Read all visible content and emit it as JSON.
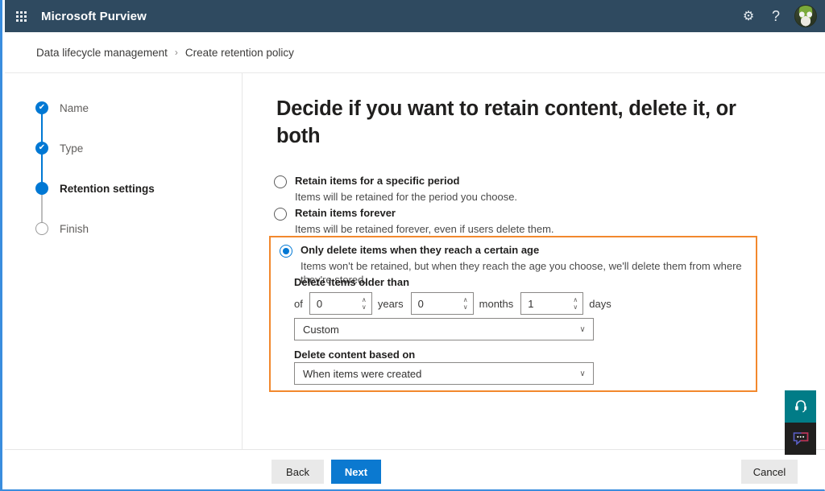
{
  "colors": {
    "header_bg": "#2f4a60",
    "accent_blue": "#0078d4",
    "primary_button": "#0b79d0",
    "highlight_border": "#f2882d",
    "help_widget_teal": "#017c87",
    "feedback_widget_dark": "#201f1e"
  },
  "header": {
    "waffle_icon": "app-launcher-waffle-icon",
    "title": "Microsoft Purview",
    "settings_icon": "gear-icon",
    "settings_glyph": "⚙",
    "help_icon": "question-mark-icon",
    "help_glyph": "?",
    "avatar_icon": "user-avatar"
  },
  "breadcrumb": {
    "items": [
      {
        "label": "Data lifecycle management"
      },
      {
        "label": "Create retention policy"
      }
    ],
    "separator": "›"
  },
  "wizard": {
    "steps": [
      {
        "label": "Name",
        "state": "done"
      },
      {
        "label": "Type",
        "state": "done"
      },
      {
        "label": "Retention settings",
        "state": "current"
      },
      {
        "label": "Finish",
        "state": "todo"
      }
    ],
    "check_glyph": "✔"
  },
  "main": {
    "title": "Decide if you want to retain content, delete it, or both",
    "options": [
      {
        "title": "Retain items for a specific period",
        "description": "Items will be retained for the period you choose.",
        "selected": false
      },
      {
        "title": "Retain items forever",
        "description": "Items will be retained forever, even if users delete them.",
        "selected": false
      },
      {
        "title": "Only delete items when they reach a certain age",
        "description": "Items won't be retained, but when they reach the age you choose, we'll delete them from where they're stored.",
        "selected": true
      }
    ],
    "delete_settings": {
      "older_than_label": "Delete items older than",
      "prefix": "of",
      "years": {
        "value": "0",
        "unit": "years"
      },
      "months": {
        "value": "0",
        "unit": "months"
      },
      "days": {
        "value": "1",
        "unit": "days"
      },
      "period_preset": "Custom",
      "based_on_label": "Delete content based on",
      "based_on_value": "When items were created",
      "chevron_glyph": "∨",
      "spin_up_glyph": "∧",
      "spin_down_glyph": "∨"
    }
  },
  "footer": {
    "back_label": "Back",
    "next_label": "Next",
    "cancel_label": "Cancel"
  },
  "side_widget": {
    "help_icon": "help-headset-icon",
    "feedback_icon": "feedback-chat-bubble-icon"
  }
}
